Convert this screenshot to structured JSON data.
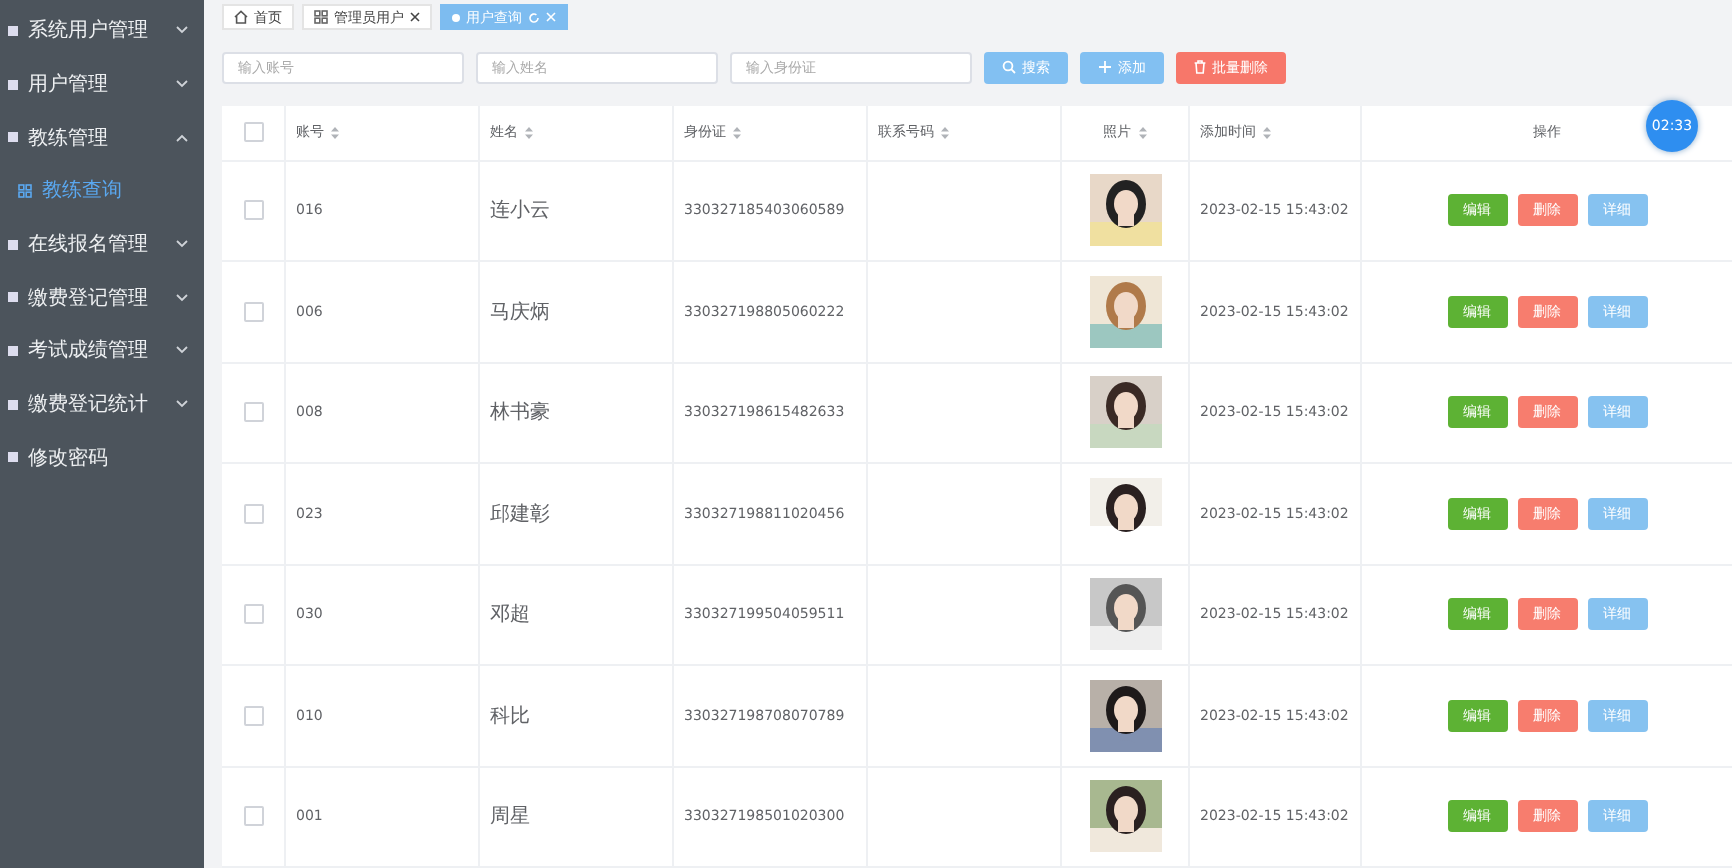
{
  "sidebar": {
    "items": [
      {
        "label": "系统用户管理",
        "kind": "group",
        "expanded": false
      },
      {
        "label": "用户管理",
        "kind": "group",
        "expanded": false
      },
      {
        "label": "教练管理",
        "kind": "group",
        "expanded": true,
        "children": [
          {
            "label": "教练查询",
            "selected": true
          }
        ]
      },
      {
        "label": "在线报名管理",
        "kind": "group",
        "expanded": false
      },
      {
        "label": "缴费登记管理",
        "kind": "group",
        "expanded": false
      },
      {
        "label": "考试成绩管理",
        "kind": "group",
        "expanded": false
      },
      {
        "label": "缴费登记统计",
        "kind": "group",
        "expanded": false
      },
      {
        "label": "修改密码",
        "kind": "link",
        "expanded": false
      }
    ]
  },
  "tabs": [
    {
      "label": "首页",
      "kind": "home",
      "selected": false
    },
    {
      "label": "管理员用户",
      "kind": "page",
      "selected": false
    },
    {
      "label": "用户查询",
      "kind": "page",
      "selected": true
    }
  ],
  "search": {
    "fields": [
      {
        "placeholder": "输入账号"
      },
      {
        "placeholder": "输入姓名"
      },
      {
        "placeholder": "输入身份证"
      }
    ],
    "buttons": [
      {
        "label": "搜索",
        "kind": "search"
      },
      {
        "label": "添加",
        "kind": "add"
      },
      {
        "label": "批量删除",
        "kind": "delete"
      }
    ]
  },
  "timer_badge": "02:33",
  "table": {
    "columns": [
      "账号",
      "姓名",
      "身份证",
      "联系号码",
      "照片",
      "添加时间",
      "操作"
    ],
    "header_checked": false,
    "rows": [
      {
        "checked": false,
        "account": "016",
        "name": "连小云",
        "id_card": "330327185403060589",
        "phone_cell": "",
        "added": "2023-02-15 15:43:02",
        "actions": [
          "编辑",
          "删除",
          "详细"
        ]
      },
      {
        "checked": false,
        "account": "006",
        "name": "马庆炳",
        "id_card": "330327198805060222",
        "added": "2023-02-15 15:43:02",
        "actions": [
          "编辑",
          "删除",
          "详细"
        ]
      },
      {
        "checked": false,
        "account": "008",
        "name": "林书豪",
        "id_card": "330327198615482633",
        "added": "2023-02-15 15:43:02",
        "actions": [
          "编辑",
          "删除",
          "详细"
        ]
      },
      {
        "checked": false,
        "account": "023",
        "name": "邱建彰",
        "id_card": "330327198811020456",
        "added": "2023-02-15 15:43:02",
        "actions": [
          "编辑",
          "删除",
          "详细"
        ]
      },
      {
        "checked": false,
        "account": "030",
        "name": "邓超",
        "id_card": "330327199504059511",
        "added": "2023-02-15 15:43:02",
        "actions": [
          "编辑",
          "删除",
          "详细"
        ]
      },
      {
        "checked": false,
        "account": "010",
        "name": "科比",
        "id_card": "330327198708070789",
        "added": "2023-02-15 15:43:02",
        "actions": [
          "编辑",
          "删除",
          "详细"
        ]
      },
      {
        "checked": false,
        "account": "001",
        "name": "周星",
        "id_card": "330327198501020300",
        "added": "2023-02-15 15:43:02",
        "actions": [
          "编辑",
          "删除",
          "详细"
        ]
      }
    ]
  }
}
